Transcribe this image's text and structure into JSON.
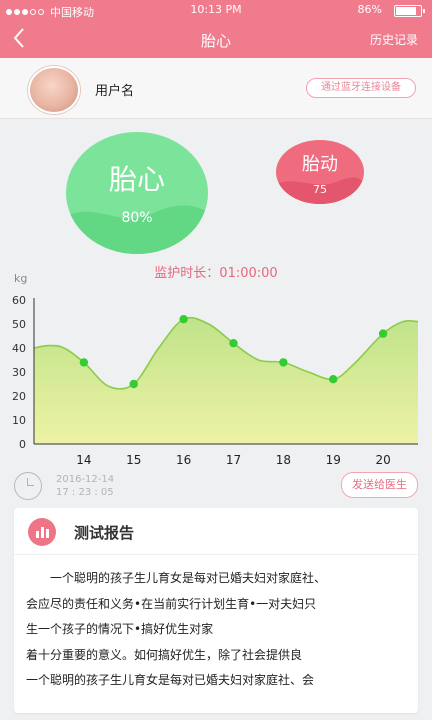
{
  "status_bar": {
    "carrier": "中国移动",
    "time": "10:13 PM",
    "battery": "86%"
  },
  "nav": {
    "back_icon": "chevron-left-icon",
    "title": "胎心",
    "history": "历史记录"
  },
  "user": {
    "name": "用户名",
    "connect_button": "通过蓝牙连接设备"
  },
  "fetal_heart": {
    "label": "胎心",
    "value": "80%",
    "color": "#7be39a"
  },
  "fetal_movement": {
    "label": "胎动",
    "value": "75",
    "color": "#ef6c7f"
  },
  "monitor": {
    "text": "监护时长：01:00:00"
  },
  "chart_data": {
    "type": "area",
    "ylabel": "kg",
    "ylim": [
      0,
      60
    ],
    "yticks": [
      "0",
      "10",
      "20",
      "30",
      "40",
      "50",
      "60"
    ],
    "categories": [
      "14",
      "15",
      "16",
      "17",
      "18",
      "19",
      "20"
    ],
    "points": [
      34,
      25,
      52,
      42,
      34,
      27,
      46
    ],
    "curve": [
      {
        "x": 13.0,
        "y": 40
      },
      {
        "x": 13.3,
        "y": 41
      },
      {
        "x": 13.6,
        "y": 40
      },
      {
        "x": 14.0,
        "y": 34
      },
      {
        "x": 14.5,
        "y": 24
      },
      {
        "x": 15.0,
        "y": 25
      },
      {
        "x": 15.5,
        "y": 40
      },
      {
        "x": 16.0,
        "y": 52
      },
      {
        "x": 16.5,
        "y": 50
      },
      {
        "x": 17.0,
        "y": 42
      },
      {
        "x": 17.5,
        "y": 35
      },
      {
        "x": 18.0,
        "y": 34
      },
      {
        "x": 18.5,
        "y": 30
      },
      {
        "x": 19.0,
        "y": 27
      },
      {
        "x": 19.4,
        "y": 33
      },
      {
        "x": 20.0,
        "y": 46
      },
      {
        "x": 20.4,
        "y": 51
      },
      {
        "x": 20.7,
        "y": 51
      }
    ],
    "grid": false,
    "line_color": "#8ccb4a",
    "point_color": "#33cc33"
  },
  "record": {
    "clock_icon": "clock-icon",
    "date": "2016-12-14",
    "time": "17 : 23 : 05",
    "send_button": "发送给医生"
  },
  "report": {
    "icon": "chart-report-icon",
    "title": "测试报告",
    "lines": [
      "一个聪明的孩子生儿育女是每对已婚夫妇对家庭社、",
      "会应尽的责任和义务•在当前实行计划生育•一对夫妇只",
      "生一个孩子的情况下•搞好优生对家",
      "着十分重要的意义。如何搞好优生，除了社会提供良",
      "一个聪明的孩子生儿育女是每对已婚夫妇对家庭社、会"
    ]
  }
}
